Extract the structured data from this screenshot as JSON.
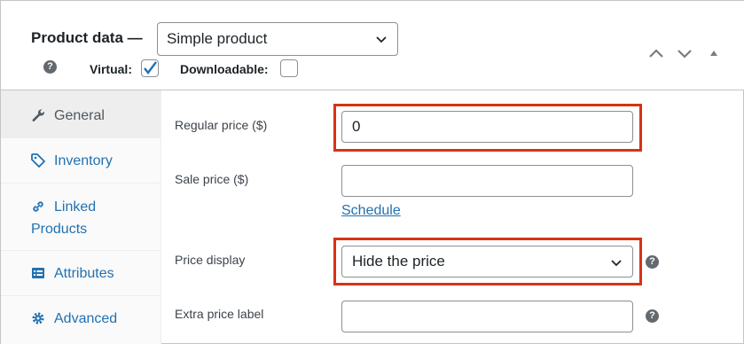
{
  "header": {
    "title": "Product data —",
    "product_type": "Simple product",
    "virtual_label": "Virtual:",
    "virtual_checked": true,
    "downloadable_label": "Downloadable:",
    "downloadable_checked": false,
    "help_glyph": "?"
  },
  "tabs": [
    {
      "label": "General",
      "icon": "wrench-icon",
      "active": true
    },
    {
      "label": "Inventory",
      "icon": "tag-icon",
      "active": false
    },
    {
      "label": "Linked",
      "label2": "Products",
      "icon": "link-icon",
      "active": false
    },
    {
      "label": "Attributes",
      "icon": "list-icon",
      "active": false
    },
    {
      "label": "Advanced",
      "icon": "gear-icon",
      "active": false
    }
  ],
  "fields": {
    "regular_price_label": "Regular price ($)",
    "regular_price_value": "0",
    "sale_price_label": "Sale price ($)",
    "sale_price_value": "",
    "schedule_link": "Schedule",
    "price_display_label": "Price display",
    "price_display_value": "Hide the price",
    "extra_price_label": "Extra price label",
    "extra_price_value": ""
  },
  "colors": {
    "accent": "#2271b1",
    "highlight": "#d63315"
  }
}
